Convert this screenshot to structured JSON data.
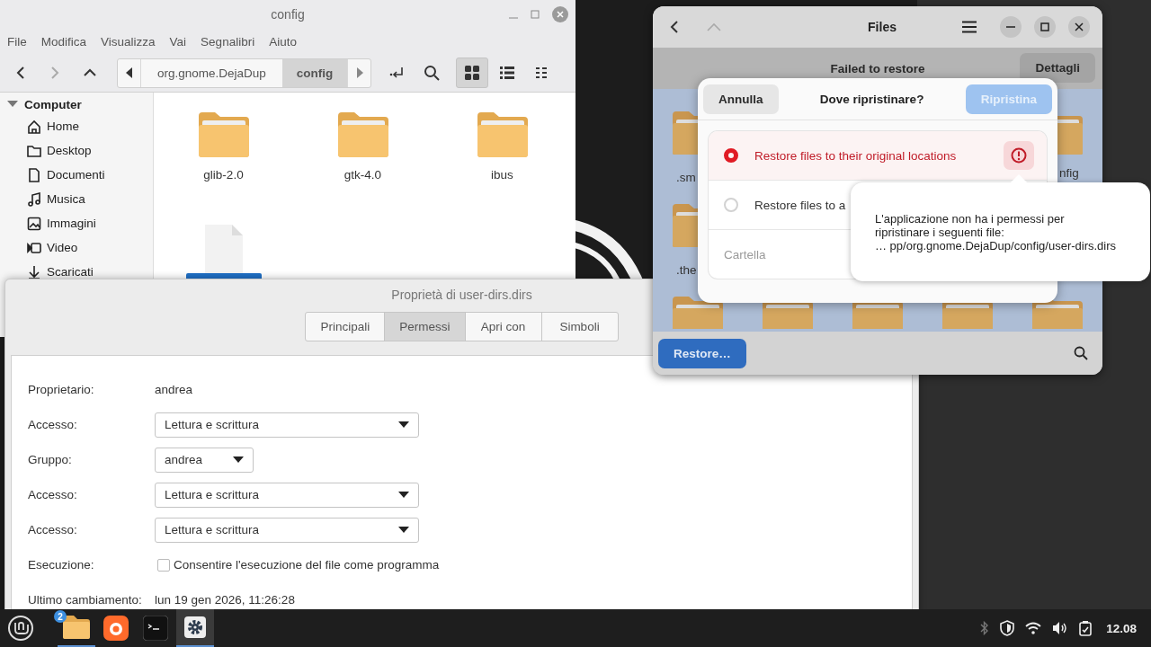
{
  "file_manager": {
    "title": "config",
    "menu": [
      "File",
      "Modifica",
      "Visualizza",
      "Vai",
      "Segnalibri",
      "Aiuto"
    ],
    "path": [
      {
        "label": "org.gnome.DejaDup",
        "selected": false
      },
      {
        "label": "config",
        "selected": true
      }
    ],
    "view_modes": [
      {
        "kind": "grid",
        "selected": true
      },
      {
        "kind": "list",
        "selected": false
      },
      {
        "kind": "compact",
        "selected": false
      }
    ],
    "sidebar": {
      "heading": "Computer",
      "expanded": true,
      "items": [
        {
          "label": "Home",
          "kind": "home"
        },
        {
          "label": "Desktop",
          "kind": "desktop"
        },
        {
          "label": "Documenti",
          "kind": "documents"
        },
        {
          "label": "Musica",
          "kind": "music"
        },
        {
          "label": "Immagini",
          "kind": "pictures"
        },
        {
          "label": "Video",
          "kind": "video"
        },
        {
          "label": "Scaricati",
          "kind": "downloads"
        }
      ]
    },
    "items": [
      {
        "kind": "folder",
        "name": "glib-2.0",
        "selected": false
      },
      {
        "kind": "folder",
        "name": "gtk-4.0",
        "selected": false
      },
      {
        "kind": "folder",
        "name": "ibus",
        "selected": false
      },
      {
        "kind": "file",
        "selected": true
      }
    ]
  },
  "properties": {
    "title": "Proprietà di user-dirs.dirs",
    "tabs": [
      {
        "label": "Principali",
        "selected": false
      },
      {
        "label": "Permessi",
        "selected": true
      },
      {
        "label": "Apri con",
        "selected": false
      },
      {
        "label": "Simboli",
        "selected": false
      }
    ],
    "rows": [
      {
        "kind": "text",
        "label": "Proprietario:",
        "value": "andrea"
      },
      {
        "kind": "select",
        "label": "Accesso:",
        "value": "Lettura e scrittura"
      },
      {
        "kind": "small_select",
        "label": "Gruppo:",
        "value": "andrea"
      },
      {
        "kind": "select",
        "label": "Accesso:",
        "value": "Lettura e scrittura"
      },
      {
        "kind": "select",
        "label": "Accesso:",
        "value": "Lettura e scrittura"
      },
      {
        "kind": "checkbox",
        "label": "Esecuzione:",
        "value": "Consentire l'esecuzione del file come programma",
        "checked": false
      },
      {
        "kind": "text",
        "label": "Ultimo cambiamento:",
        "value": "lun 19 gen 2026, 11:26:28"
      }
    ]
  },
  "files_window": {
    "title": "Files",
    "banner": {
      "text": "Failed to restore",
      "button": "Dettagli"
    },
    "grid_labels": [
      ".sm",
      "nfig",
      ".the"
    ],
    "restore_button": "Restore…"
  },
  "restore_dialog": {
    "title": "Dove ripristinare?",
    "cancel": "Annulla",
    "confirm": {
      "label": "Ripristina",
      "disabled": true
    },
    "options": [
      {
        "label": "Restore files to their original locations",
        "selected": true,
        "error": true
      },
      {
        "label": "Restore files to a",
        "selected": false,
        "error": false
      }
    ],
    "folder_field": {
      "placeholder": "Cartella"
    }
  },
  "popover": {
    "text": "L'applicazione non ha i permessi per\nripristinare i seguenti file:\n… pp/org.gnome.DejaDup/config/user-dirs.dirs"
  },
  "taskbar": {
    "apps": [
      {
        "kind": "files",
        "badge": "2",
        "running": true,
        "active": false
      },
      {
        "kind": "browser",
        "running": false,
        "active": false
      },
      {
        "kind": "terminal",
        "running": false,
        "active": false
      },
      {
        "kind": "settings",
        "running": true,
        "active": true
      }
    ],
    "clock": "12.08"
  }
}
